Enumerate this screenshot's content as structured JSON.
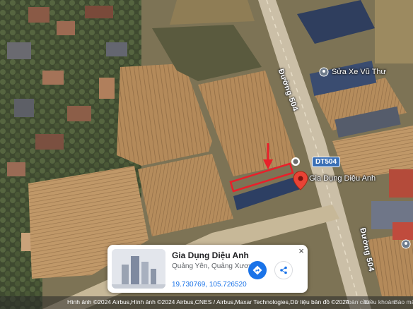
{
  "map": {
    "roads": {
      "duong_504_upper": "Đường 504",
      "duong_504_lower": "Đường 504",
      "route_shield": "DT504"
    },
    "pois": {
      "repair_shop": "Sửa Xe Vũ Thư",
      "store_label": "Gia Dụng Diệu Anh"
    },
    "colors": {
      "marker": "#ea4335",
      "annotation": "#e8202a"
    }
  },
  "place_card": {
    "name": "Gia Dụng Diệu Anh",
    "address": "Quảng Yên, Quảng Xươn…",
    "coordinates": "19.730769, 105.726520",
    "directions_icon": "directions-icon",
    "share_icon": "share-icon",
    "close_label": "×"
  },
  "footer": {
    "attribution": "Hình ảnh ©2024 Airbus,Hình ảnh ©2024 Airbus,CNES / Airbus,Maxar Technologies,Dữ liệu bản đồ ©2024",
    "links": [
      "Toàn cầu",
      "Điều khoản",
      "Báo mả"
    ]
  }
}
